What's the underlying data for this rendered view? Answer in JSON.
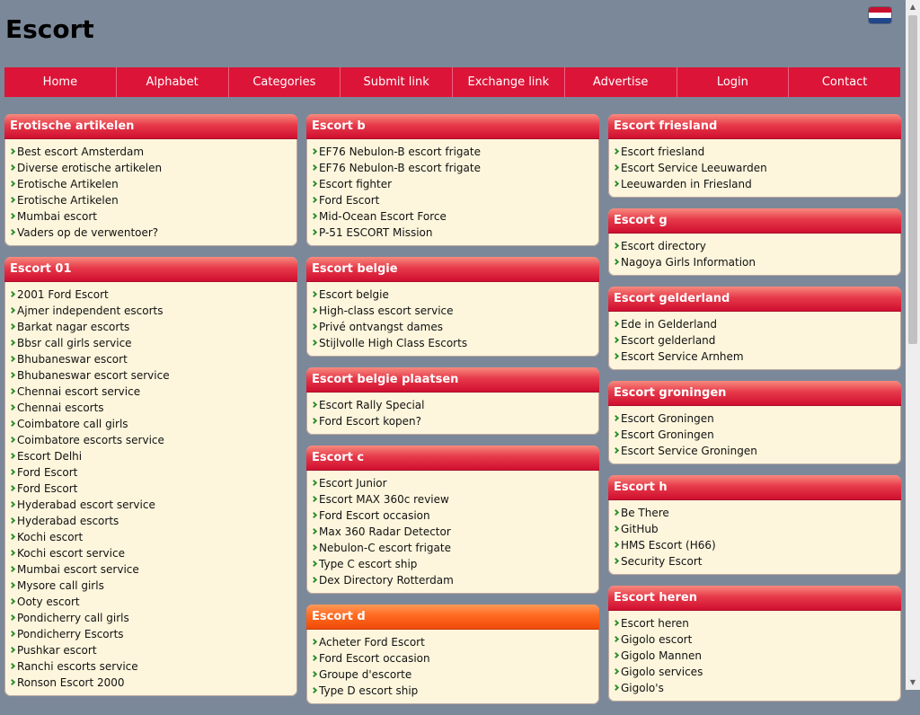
{
  "header": {
    "title": "Escort",
    "flag_icon": "netherlands-flag-icon"
  },
  "nav": [
    "Home",
    "Alphabet",
    "Categories",
    "Submit link",
    "Exchange link",
    "Advertise",
    "Login",
    "Contact"
  ],
  "colors": {
    "background": "#7b8899",
    "nav": "#dc1438",
    "box_body": "#fdf6dd",
    "box_head_red": "#d00f30",
    "box_head_orange": "#f04a08",
    "bullet": "#2f8f2f"
  },
  "columns": [
    [
      {
        "title": "Erotische artikelen",
        "links": [
          "Best escort Amsterdam",
          "Diverse erotische artikelen",
          "Erotische Artikelen",
          "Erotische Artikelen",
          "Mumbai escort",
          "Vaders op de verwentoer?"
        ]
      },
      {
        "title": "Escort 01",
        "links": [
          "2001 Ford Escort",
          "Ajmer independent escorts",
          "Barkat nagar escorts",
          "Bbsr call girls service",
          "Bhubaneswar escort",
          "Bhubaneswar escort service",
          "Chennai escort service",
          "Chennai escorts",
          "Coimbatore call girls",
          "Coimbatore escorts service",
          "Escort Delhi",
          "Ford Escort",
          "Ford Escort",
          "Hyderabad escort service",
          "Hyderabad escorts",
          "Kochi escort",
          "Kochi escort service",
          "Mumbai escort service",
          "Mysore call girls",
          "Ooty escort",
          "Pondicherry call girls",
          "Pondicherry Escorts",
          "Pushkar escort",
          "Ranchi escorts service",
          "Ronson Escort 2000"
        ]
      }
    ],
    [
      {
        "title": "Escort b",
        "links": [
          "EF76 Nebulon-B escort frigate",
          "EF76 Nebulon-B escort frigate",
          "Escort fighter",
          "Ford Escort",
          "Mid-Ocean Escort Force",
          "P-51 ESCORT Mission"
        ]
      },
      {
        "title": "Escort belgie",
        "links": [
          "Escort belgie",
          "High-class escort service",
          "Privé ontvangst dames",
          "Stijlvolle High Class Escorts"
        ]
      },
      {
        "title": "Escort belgie plaatsen",
        "links": [
          "Escort Rally Special",
          "Ford Escort kopen?"
        ]
      },
      {
        "title": "Escort c",
        "links": [
          "Escort Junior",
          "Escort MAX 360c review",
          "Ford Escort occasion",
          "Max 360 Radar Detector",
          "Nebulon-C escort frigate",
          "Type C escort ship",
          "Dex Directory Rotterdam"
        ]
      },
      {
        "title": "Escort d",
        "style": "orange",
        "links": [
          "Acheter Ford Escort",
          "Ford Escort occasion",
          "Groupe d'escorte",
          "Type D escort ship"
        ]
      }
    ],
    [
      {
        "title": "Escort friesland",
        "links": [
          "Escort friesland",
          "Escort Service Leeuwarden",
          "Leeuwarden in Friesland"
        ]
      },
      {
        "title": "Escort g",
        "links": [
          "Escort directory",
          "Nagoya Girls Information"
        ]
      },
      {
        "title": "Escort gelderland",
        "links": [
          "Ede in Gelderland",
          "Escort gelderland",
          "Escort Service Arnhem"
        ]
      },
      {
        "title": "Escort groningen",
        "links": [
          "Escort Groningen",
          "Escort Groningen",
          "Escort Service Groningen"
        ]
      },
      {
        "title": "Escort h",
        "links": [
          "Be There",
          "GitHub",
          "HMS Escort (H66)",
          "Security Escort"
        ]
      },
      {
        "title": "Escort heren",
        "links": [
          "Escort heren",
          "Gigolo escort",
          "Gigolo Mannen",
          "Gigolo services",
          "Gigolo's"
        ]
      }
    ]
  ]
}
